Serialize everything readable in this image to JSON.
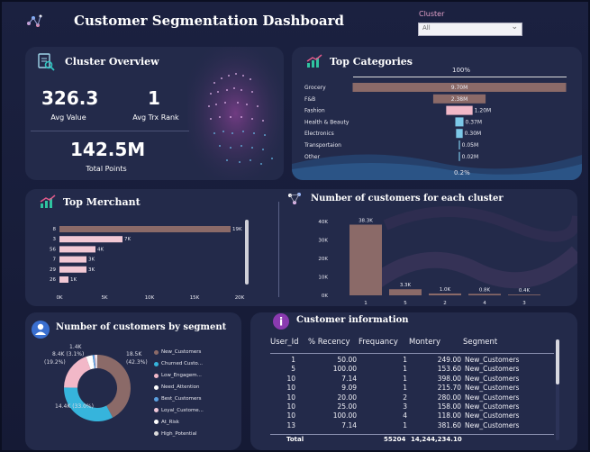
{
  "header": {
    "title": "Customer Segmentation Dashboard",
    "cluster_filter_label": "Cluster",
    "cluster_filter_value": "All"
  },
  "cluster_overview": {
    "title": "Cluster Overview",
    "avg_value": "326.3",
    "avg_value_label": "Avg Value",
    "avg_trx_rank": "1",
    "avg_trx_rank_label": "Avg Trx Rank",
    "total_points": "142.5M",
    "total_points_label": "Total Points"
  },
  "top_categories": {
    "title": "Top Categories",
    "top_pct": "100%",
    "bottom_pct": "0.2%",
    "chart_data": {
      "type": "bar",
      "categories": [
        "Grocery",
        "F&B",
        "Fashion",
        "Health & Beauty",
        "Electronics",
        "Transportaion",
        "Other"
      ],
      "values": [
        9.7,
        2.38,
        1.2,
        0.37,
        0.3,
        0.05,
        0.02
      ],
      "labels": [
        "9.70M",
        "2.38M",
        "1.20M",
        "0.37M",
        "0.30M",
        "0.05M",
        "0.02M"
      ],
      "unit": "M"
    }
  },
  "top_merchant": {
    "title": "Top Merchant",
    "chart_data": {
      "type": "bar",
      "categories": [
        "8",
        "3",
        "56",
        "7",
        "29",
        "26"
      ],
      "values": [
        19000,
        7000,
        4000,
        3000,
        3000,
        1000
      ],
      "labels": [
        "19K",
        "7K",
        "4K",
        "3K",
        "3K",
        "1K"
      ],
      "xticks": [
        "0K",
        "5K",
        "10K",
        "15K",
        "20K"
      ],
      "xlim": [
        0,
        20000
      ]
    }
  },
  "customers_per_cluster": {
    "title": "Number of customers for each cluster",
    "chart_data": {
      "type": "bar",
      "categories": [
        "1",
        "5",
        "2",
        "4",
        "3"
      ],
      "values": [
        38300,
        3300,
        1000,
        800,
        400
      ],
      "labels": [
        "38.3K",
        "3.3K",
        "1.0K",
        "0.8K",
        "0.4K"
      ],
      "yticks": [
        "0K",
        "10K",
        "20K",
        "30K",
        "40K"
      ],
      "ylim": [
        0,
        40000
      ]
    }
  },
  "customers_by_segment": {
    "title": "Number of customers by segment",
    "chart_data": {
      "type": "pie",
      "categories": [
        "New_Customers",
        "Churned Custo...",
        "Low_Engagem...",
        "Need_Attention",
        "Best_Customers",
        "Loyal_Custome...",
        "At_Risk",
        "High_Potential"
      ],
      "values": [
        18.5,
        14.4,
        8.4,
        1.4,
        0.4,
        0.3,
        0.2,
        0.1
      ],
      "labels_shown": [
        "18.5K (42.3%)",
        "14.4K (33.0%)",
        "8.4K (19.2%)",
        "1.4K (3.1%)"
      ],
      "colors": [
        "#8b6a68",
        "#36b4dc",
        "#f2b8c8",
        "#ffffff",
        "#5aa0e0",
        "#f0c8d8",
        "#ffffff",
        "#dcdcdc"
      ]
    },
    "label_a_top": "18.5K",
    "label_a_bot": "(42.3%)",
    "label_b": "14.4K (33.0%)",
    "label_c_top": "8.4K",
    "label_c_mid": "(19.2%)",
    "label_d": "1.4K",
    "label_d2": "(3.1%)"
  },
  "customer_info": {
    "title": "Customer information",
    "columns": [
      "User_Id",
      "% Recency",
      "Frequancy",
      "Montery",
      "Segment"
    ],
    "rows": [
      [
        "1",
        "50.00",
        "1",
        "249.00",
        "New_Customers"
      ],
      [
        "5",
        "100.00",
        "1",
        "153.60",
        "New_Customers"
      ],
      [
        "10",
        "7.14",
        "1",
        "398.00",
        "New_Customers"
      ],
      [
        "10",
        "9.09",
        "1",
        "215.70",
        "New_Customers"
      ],
      [
        "10",
        "20.00",
        "2",
        "280.00",
        "New_Customers"
      ],
      [
        "10",
        "25.00",
        "3",
        "158.00",
        "New_Customers"
      ],
      [
        "10",
        "100.00",
        "4",
        "118.00",
        "New_Customers"
      ],
      [
        "13",
        "7.14",
        "1",
        "381.60",
        "New_Customers"
      ]
    ],
    "total_label": "Total",
    "total_frequency": "55204",
    "total_montery": "14,244,234.10"
  }
}
